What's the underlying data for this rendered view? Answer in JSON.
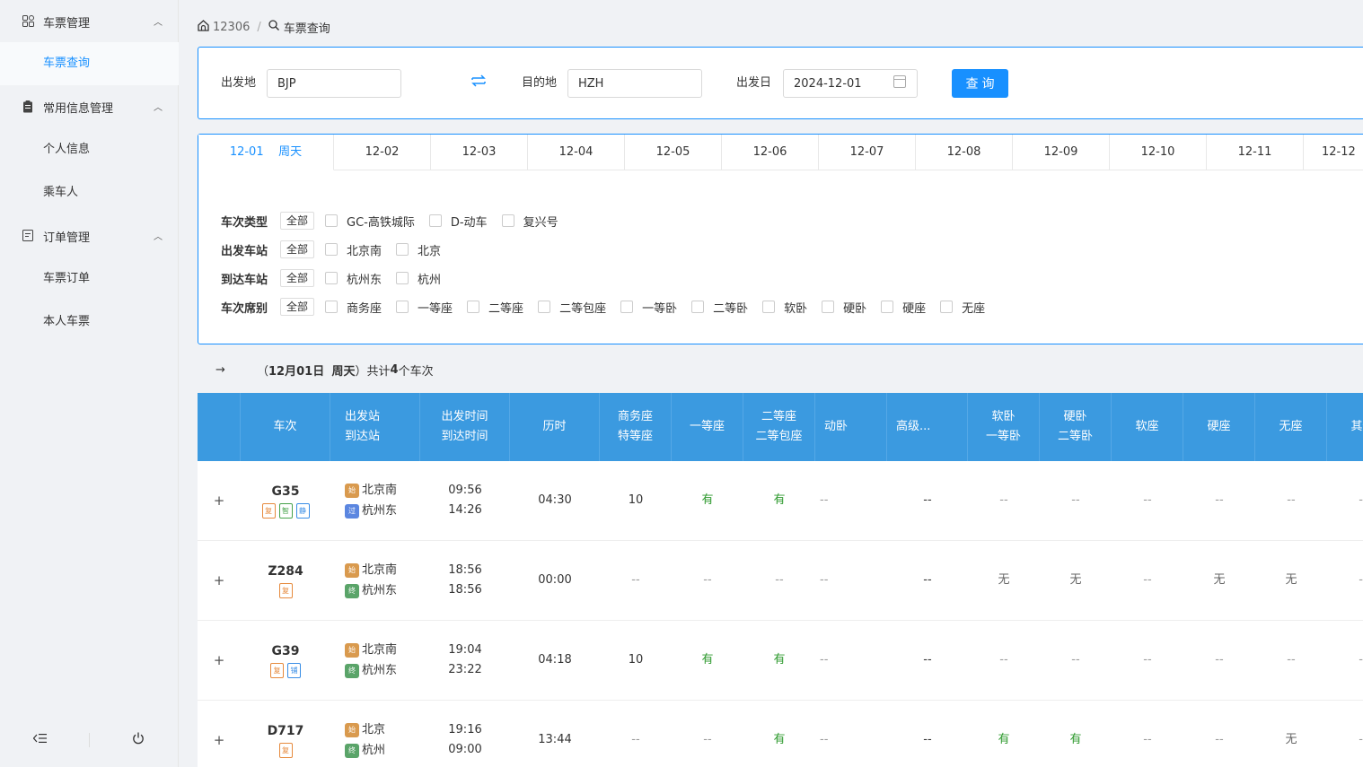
{
  "sidebar": {
    "groups": [
      {
        "label": "车票管理",
        "icon": "grid-icon",
        "items": [
          {
            "label": "车票查询",
            "active": true
          }
        ]
      },
      {
        "label": "常用信息管理",
        "icon": "clipboard-icon",
        "items": [
          {
            "label": "个人信息"
          },
          {
            "label": "乘车人"
          }
        ]
      },
      {
        "label": "订单管理",
        "icon": "order-icon",
        "items": [
          {
            "label": "车票订单"
          },
          {
            "label": "本人车票"
          }
        ]
      }
    ],
    "collapse_icon": "menu-fold-icon",
    "power_icon": "power-icon"
  },
  "breadcrumb": {
    "home": "12306",
    "sep": "/",
    "current": "车票查询"
  },
  "search": {
    "from_label": "出发地",
    "from_value": "BJP",
    "to_label": "目的地",
    "to_value": "HZH",
    "date_label": "出发日",
    "date_value": "2024-12-01",
    "query_label": "查询"
  },
  "tabs": [
    {
      "date": "12-01",
      "week": "周天",
      "active": true
    },
    {
      "date": "12-02"
    },
    {
      "date": "12-03"
    },
    {
      "date": "12-04"
    },
    {
      "date": "12-05"
    },
    {
      "date": "12-06"
    },
    {
      "date": "12-07"
    },
    {
      "date": "12-08"
    },
    {
      "date": "12-09"
    },
    {
      "date": "12-10"
    },
    {
      "date": "12-11"
    },
    {
      "date": "12-12"
    }
  ],
  "filters": {
    "all_label": "全部",
    "rows": [
      {
        "label": "车次类型",
        "options": [
          "GC-高铁城际",
          "D-动车",
          "复兴号"
        ]
      },
      {
        "label": "出发车站",
        "options": [
          "北京南",
          "北京"
        ]
      },
      {
        "label": "到达车站",
        "options": [
          "杭州东",
          "杭州"
        ]
      },
      {
        "label": "车次席别",
        "options": [
          "商务座",
          "一等座",
          "二等座",
          "二等包座",
          "一等卧",
          "二等卧",
          "软卧",
          "硬卧",
          "硬座",
          "无座"
        ]
      }
    ]
  },
  "summary": {
    "arrow": "→",
    "open": "（",
    "date": "12月01日",
    "week": "周天",
    "close": "）",
    "prefix": "共计",
    "count": "4",
    "suffix": "个车次"
  },
  "table": {
    "headers": [
      [
        "车次"
      ],
      [
        "出发站",
        "到达站"
      ],
      [
        "出发时间",
        "到达时间"
      ],
      [
        "历时"
      ],
      [
        "商务座",
        "特等座"
      ],
      [
        "一等座"
      ],
      [
        "二等座",
        "二等包座"
      ],
      [
        "动卧"
      ],
      [
        "高级..."
      ],
      [
        "软卧",
        "一等卧"
      ],
      [
        "硬卧",
        "二等卧"
      ],
      [
        "软座"
      ],
      [
        "硬座"
      ],
      [
        "无座"
      ],
      [
        "其他"
      ]
    ],
    "rows": [
      {
        "train": "G35",
        "badges": [
          [
            "复",
            "o"
          ],
          [
            "智",
            "g"
          ],
          [
            "静",
            "b"
          ]
        ],
        "from": "北京南",
        "from_tag": "始",
        "to": "杭州东",
        "to_tag": "过",
        "dep": "09:56",
        "arr": "14:26",
        "dur": "04:30",
        "seats": [
          "10",
          "有",
          "有",
          "--",
          "--",
          "--",
          "--",
          "--",
          "--",
          "--",
          "--"
        ]
      },
      {
        "train": "Z284",
        "badges": [
          [
            "复",
            "o"
          ]
        ],
        "from": "北京南",
        "from_tag": "始",
        "to": "杭州东",
        "to_tag": "终",
        "dep": "18:56",
        "arr": "18:56",
        "dur": "00:00",
        "seats": [
          "--",
          "--",
          "--",
          "--",
          "--",
          "无",
          "无",
          "--",
          "无",
          "无",
          "--"
        ]
      },
      {
        "train": "G39",
        "badges": [
          [
            "复",
            "o"
          ],
          [
            "铺",
            "b"
          ]
        ],
        "from": "北京南",
        "from_tag": "始",
        "to": "杭州东",
        "to_tag": "终",
        "dep": "19:04",
        "arr": "23:22",
        "dur": "04:18",
        "seats": [
          "10",
          "有",
          "有",
          "--",
          "--",
          "--",
          "--",
          "--",
          "--",
          "--",
          "--"
        ]
      },
      {
        "train": "D717",
        "badges": [
          [
            "复",
            "o"
          ]
        ],
        "from": "北京",
        "from_tag": "始",
        "to": "杭州",
        "to_tag": "终",
        "dep": "19:16",
        "arr": "09:00",
        "dur": "13:44",
        "seats": [
          "--",
          "--",
          "有",
          "--",
          "--",
          "有",
          "有",
          "--",
          "--",
          "无",
          "--"
        ]
      }
    ]
  },
  "colors": {
    "accent": "#1890ff",
    "header": "#3b9ae0",
    "available": "#2e9a2e"
  }
}
